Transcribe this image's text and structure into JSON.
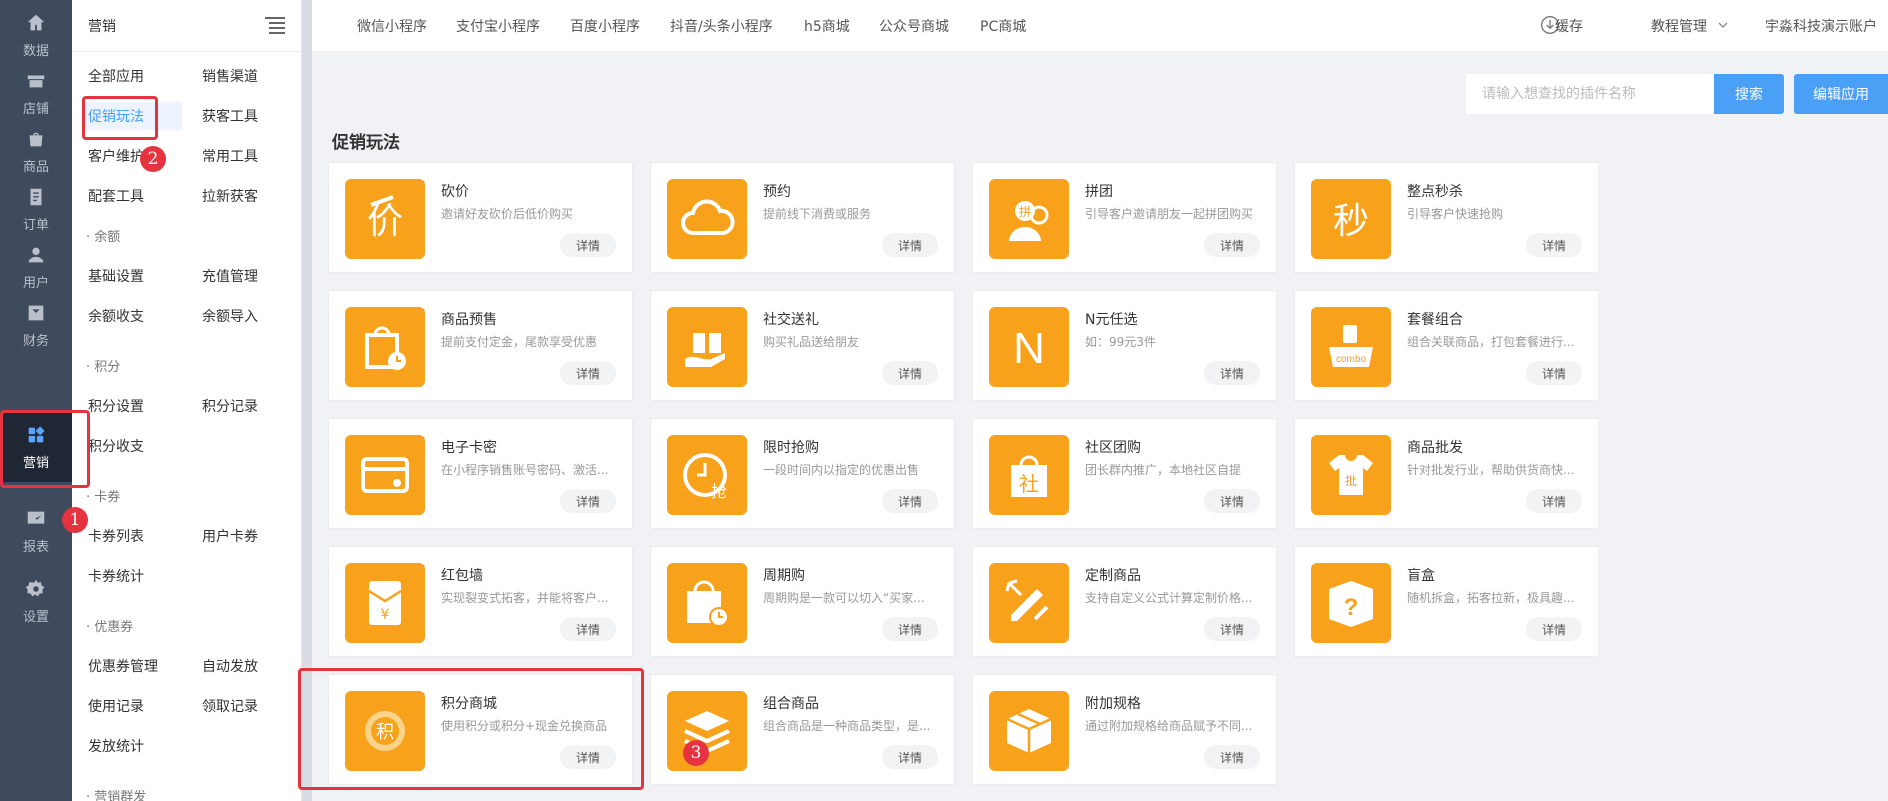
{
  "rail": {
    "items": [
      {
        "label": "数据",
        "icon": "home-icon"
      },
      {
        "label": "店铺",
        "icon": "store-icon"
      },
      {
        "label": "商品",
        "icon": "bag-icon"
      },
      {
        "label": "订单",
        "icon": "order-icon"
      },
      {
        "label": "用户",
        "icon": "user-icon"
      },
      {
        "label": "财务",
        "icon": "finance-icon"
      },
      {
        "label": "营销",
        "icon": "apps-icon"
      },
      {
        "label": "报表",
        "icon": "chart-icon"
      },
      {
        "label": "设置",
        "icon": "gear-icon"
      }
    ],
    "active": "营销"
  },
  "submenu": {
    "title": "营销",
    "rows": [
      [
        "全部应用",
        "销售渠道"
      ],
      [
        "促销玩法",
        "获客工具"
      ],
      [
        "客户维护",
        "常用工具"
      ],
      [
        "配套工具",
        "拉新获客"
      ]
    ],
    "active": "促销玩法",
    "sections": [
      {
        "title": "· 余额",
        "rows": [
          [
            "基础设置",
            "充值管理"
          ],
          [
            "余额收支",
            "余额导入"
          ]
        ]
      },
      {
        "title": "· 积分",
        "rows": [
          [
            "积分设置",
            "积分记录"
          ],
          [
            "积分收支",
            ""
          ]
        ]
      },
      {
        "title": "· 卡券",
        "rows": [
          [
            "卡券列表",
            "用户卡券"
          ],
          [
            "卡券统计",
            ""
          ]
        ]
      },
      {
        "title": "· 优惠券",
        "rows": [
          [
            "优惠券管理",
            "自动发放"
          ],
          [
            "使用记录",
            "领取记录"
          ],
          [
            "发放统计",
            ""
          ]
        ]
      },
      {
        "title": "· 营销群发",
        "rows": []
      }
    ]
  },
  "topbar": {
    "tabs": [
      "微信小程序",
      "支付宝小程序",
      "百度小程序",
      "抖音/头条小程序",
      "h5商城",
      "公众号商城",
      "PC商城"
    ],
    "cache": "缓存",
    "tutorial": "教程管理",
    "account": "宇淼科技演示账户"
  },
  "search": {
    "placeholder": "请输入想查找的插件名称",
    "button": "搜索"
  },
  "edit_button": "编辑应用",
  "section_title": "促销玩法",
  "detail_label": "详情",
  "plugins": [
    {
      "name": "砍价",
      "desc": "邀请好友砍价后低价购买",
      "icon": "bargain-icon"
    },
    {
      "name": "预约",
      "desc": "提前线下消费或服务",
      "icon": "cloud-icon"
    },
    {
      "name": "拼团",
      "desc": "引导客户邀请朋友一起拼团购买",
      "icon": "group-buy-icon"
    },
    {
      "name": "整点秒杀",
      "desc": "引导客户快速抢购",
      "icon": "flash-sale-icon"
    },
    {
      "name": "商品预售",
      "desc": "提前支付定金，尾款享受优惠",
      "icon": "presale-bag-icon"
    },
    {
      "name": "社交送礼",
      "desc": "购买礼品送给朋友",
      "icon": "gift-icon"
    },
    {
      "name": "N元任选",
      "desc": "如：99元3件",
      "icon": "n-letter-icon"
    },
    {
      "name": "套餐组合",
      "desc": "组合关联商品，打包套餐进行...",
      "icon": "combo-icon"
    },
    {
      "name": "电子卡密",
      "desc": "在小程序销售账号密码、激活...",
      "icon": "card-key-icon"
    },
    {
      "name": "限时抢购",
      "desc": "一段时间内以指定的优惠出售",
      "icon": "timed-grab-icon"
    },
    {
      "name": "社区团购",
      "desc": "团长群内推广，本地社区自提",
      "icon": "community-bag-icon"
    },
    {
      "name": "商品批发",
      "desc": "针对批发行业，帮助供货商快...",
      "icon": "wholesale-shirt-icon"
    },
    {
      "name": "红包墙",
      "desc": "实现裂变式拓客，并能将客户...",
      "icon": "red-envelope-icon"
    },
    {
      "name": "周期购",
      "desc": "周期购是一款可以切入“买家...",
      "icon": "cycle-bag-icon"
    },
    {
      "name": "定制商品",
      "desc": "支持自定义公式计算定制价格...",
      "icon": "pencil-ruler-icon"
    },
    {
      "name": "盲盒",
      "desc": "随机拆盒，拓客拉新，极具趣...",
      "icon": "mystery-box-icon"
    },
    {
      "name": "积分商城",
      "desc": "使用积分或积分+现金兑换商品",
      "icon": "points-coin-icon"
    },
    {
      "name": "组合商品",
      "desc": "组合商品是一种商品类型，是...",
      "icon": "stack-layers-icon"
    },
    {
      "name": "附加规格",
      "desc": "通过附加规格给商品赋予不同...",
      "icon": "package-box-icon"
    }
  ],
  "annotations": {
    "badge1": "1",
    "badge2": "2",
    "badge3": "3",
    "color": "#e5343f"
  },
  "colors": {
    "accent": "#409eff",
    "icon_bg": "#f8a21c",
    "rail_bg": "#3f4a5c",
    "button": "#4aa0f5"
  }
}
